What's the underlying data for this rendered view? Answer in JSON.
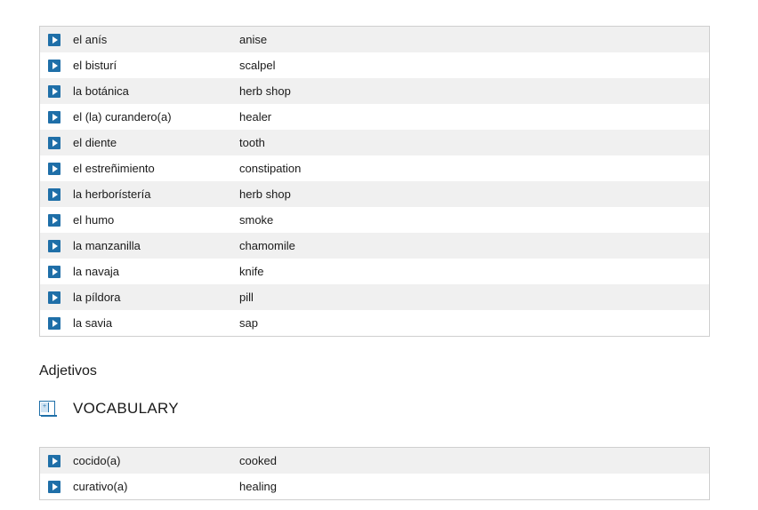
{
  "nouns_table": {
    "rows": [
      {
        "term": "el anís",
        "translation": "anise"
      },
      {
        "term": "el bisturí",
        "translation": "scalpel"
      },
      {
        "term": "la botánica",
        "translation": "herb shop"
      },
      {
        "term": "el (la) curandero(a)",
        "translation": "healer"
      },
      {
        "term": "el diente",
        "translation": "tooth"
      },
      {
        "term": "el estreñimiento",
        "translation": "constipation"
      },
      {
        "term": "la herborístería",
        "translation": "herb shop"
      },
      {
        "term": "el humo",
        "translation": "smoke"
      },
      {
        "term": "la manzanilla",
        "translation": "chamomile"
      },
      {
        "term": "la navaja",
        "translation": "knife"
      },
      {
        "term": "la píldora",
        "translation": "pill"
      },
      {
        "term": "la savia",
        "translation": "sap"
      }
    ]
  },
  "adjectives_section": {
    "heading": "Adjetivos",
    "vocabulary_label": "VOCABULARY",
    "rows": [
      {
        "term": "cocido(a)",
        "translation": "cooked"
      },
      {
        "term": "curativo(a)",
        "translation": "healing"
      }
    ]
  },
  "colors": {
    "play_button": "#1f6fa8",
    "row_stripe": "#f0f0f0",
    "table_border": "#cfcfcf"
  },
  "icons": {
    "row_audio": "play-icon",
    "vocabulary": "book-icon"
  }
}
